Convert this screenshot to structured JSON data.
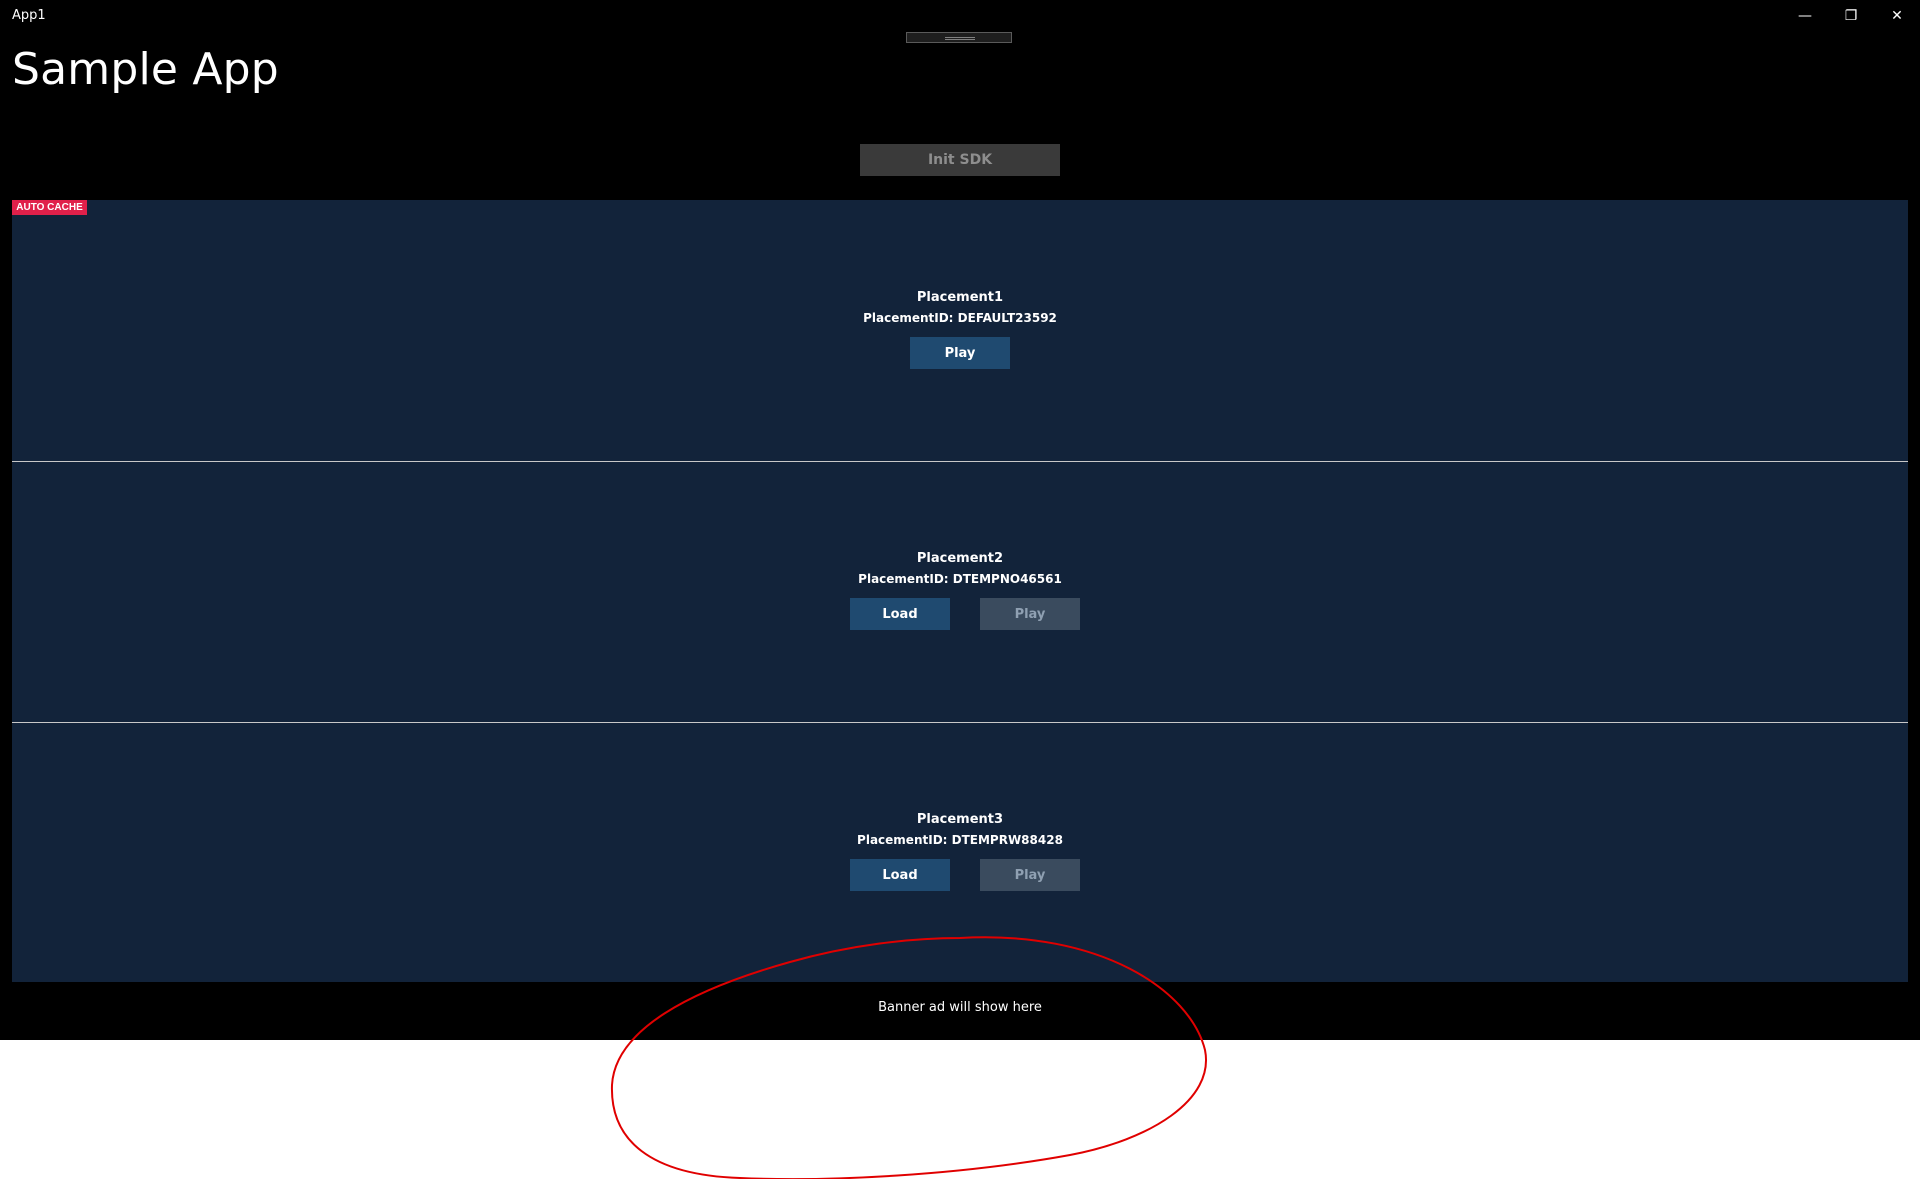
{
  "window": {
    "title": "App1",
    "minimize_glyph": "—",
    "maximize_glyph": "❐",
    "close_glyph": "✕"
  },
  "page": {
    "title": "Sample App",
    "init_button": "Init SDK",
    "auto_cache_badge": "AUTO CACHE",
    "banner_text": "Banner ad will show here"
  },
  "placements": [
    {
      "name": "Placement1",
      "id_text": "PlacementID: DEFAULT23592",
      "play_label": "Play"
    },
    {
      "name": "Placement2",
      "id_text": "PlacementID: DTEMPNO46561",
      "load_label": "Load",
      "play_label": "Play"
    },
    {
      "name": "Placement3",
      "id_text": "PlacementID: DTEMPRW88428",
      "load_label": "Load",
      "play_label": "Play"
    }
  ],
  "colors": {
    "background": "#000000",
    "section": "#12233a",
    "button_active": "#1f4a70",
    "button_disabled": "#3a4b5e",
    "badge": "#e0204a",
    "annotation": "#e00000"
  },
  "icons": {
    "minimize": "minimize-icon",
    "maximize": "restore-icon",
    "close": "close-icon"
  }
}
